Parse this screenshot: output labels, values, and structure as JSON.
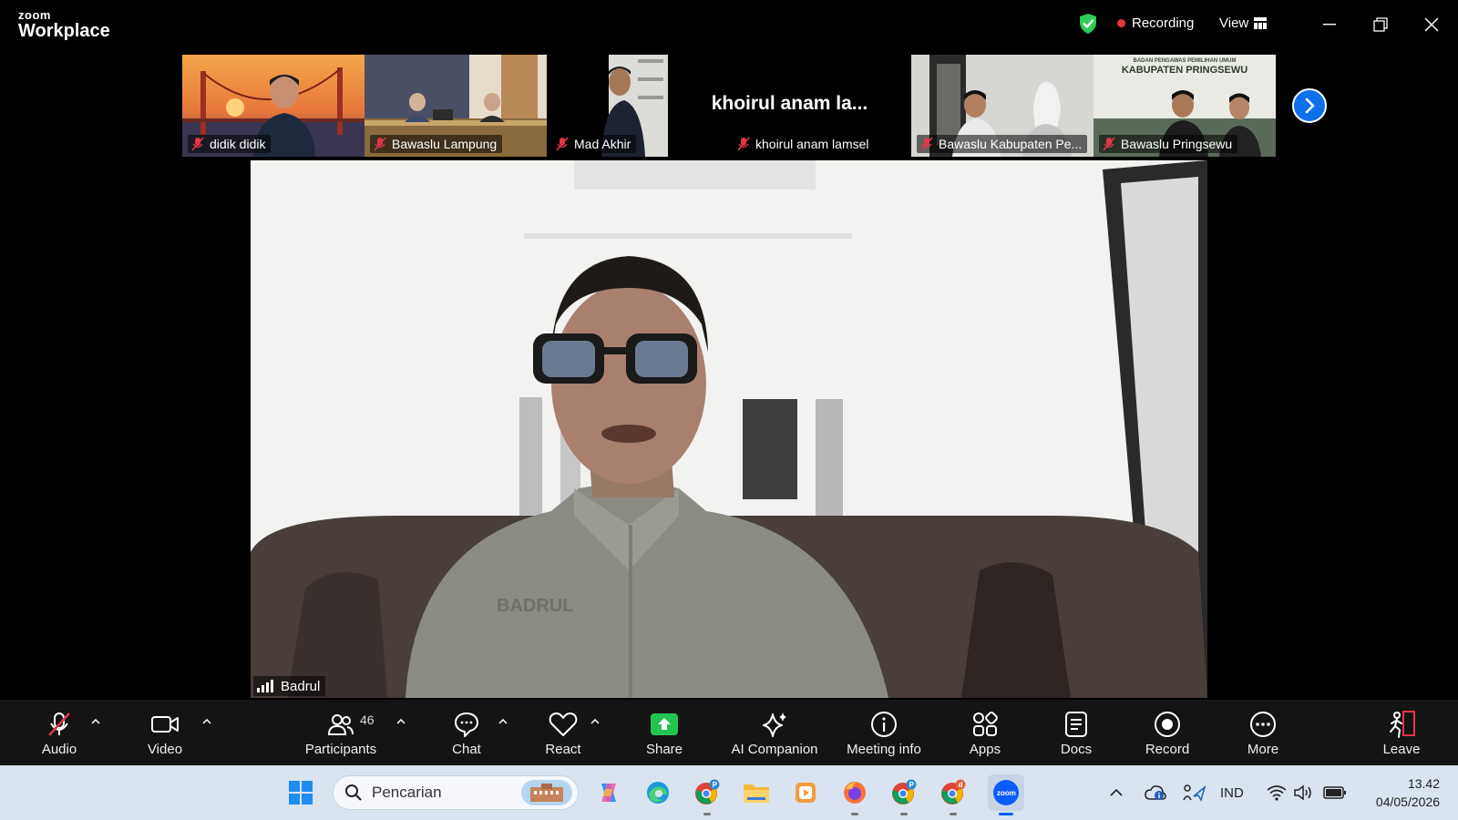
{
  "app": {
    "brand_small": "zoom",
    "brand_large": "Workplace"
  },
  "header": {
    "recording_label": "Recording",
    "view_label": "View"
  },
  "thumbnails": [
    {
      "name": "didik didik"
    },
    {
      "name": "Bawaslu Lampung"
    },
    {
      "name": "Mad Akhir"
    },
    {
      "name": "khoirul anam lamsel",
      "display_name": "khoirul anam la..."
    },
    {
      "name": "Bawaslu Kabupaten Pe..."
    },
    {
      "name": "Bawaslu Pringsewu",
      "banner_line1": "BADAN PENGAWAS PEMILIHAN UMUM",
      "banner_line2": "KABUPATEN PRINGSEWU"
    }
  ],
  "main_speaker": {
    "name": "Badrul"
  },
  "toolbar": {
    "audio": "Audio",
    "video": "Video",
    "participants": "Participants",
    "participants_count": "46",
    "chat": "Chat",
    "react": "React",
    "share": "Share",
    "ai_companion": "AI Companion",
    "meeting_info": "Meeting info",
    "apps": "Apps",
    "docs": "Docs",
    "record": "Record",
    "more": "More",
    "leave": "Leave"
  },
  "taskbar": {
    "search_placeholder": "Pencarian",
    "language": "IND",
    "time": "13.42",
    "date": "04/05/2026"
  },
  "colors": {
    "accent_blue": "#0e71eb",
    "share_green": "#23c552",
    "recording_red": "#e8343c",
    "shield_green": "#2ecc55"
  }
}
